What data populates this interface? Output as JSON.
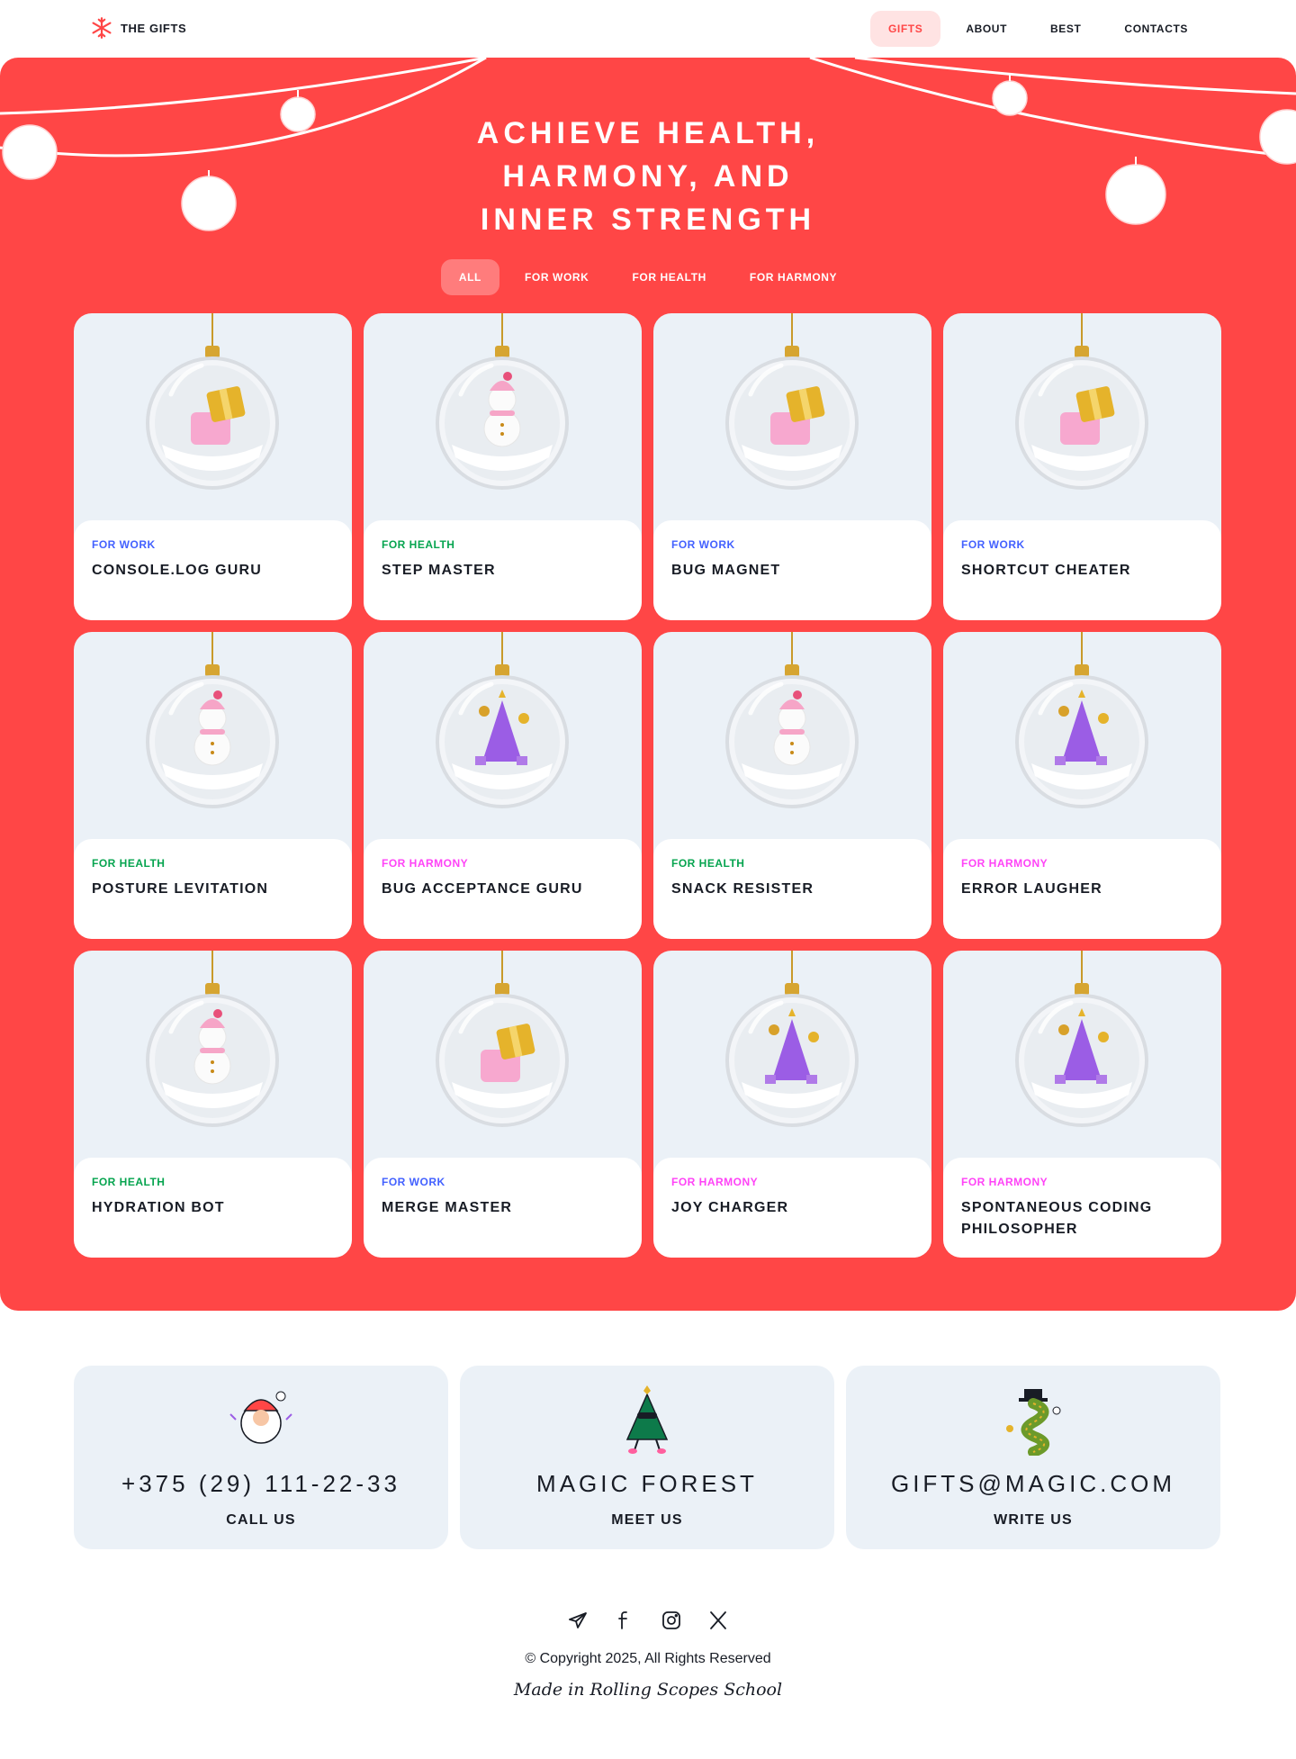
{
  "header": {
    "logo_text": "THE GIFTS",
    "nav": [
      {
        "label": "GIFTS",
        "active": true
      },
      {
        "label": "ABOUT",
        "active": false
      },
      {
        "label": "BEST",
        "active": false
      },
      {
        "label": "CONTACTS",
        "active": false
      }
    ]
  },
  "hero": {
    "title_lines": [
      "ACHIEVE HEALTH,",
      "HARMONY, AND",
      "INNER STRENGTH"
    ],
    "tabs": [
      {
        "label": "ALL",
        "active": true
      },
      {
        "label": "FOR WORK",
        "active": false
      },
      {
        "label": "FOR HEALTH",
        "active": false
      },
      {
        "label": "FOR HARMONY",
        "active": false
      }
    ]
  },
  "cards": [
    {
      "category": "FOR WORK",
      "name": "CONSOLE.LOG GURU",
      "type": "work",
      "toy": "gift"
    },
    {
      "category": "FOR HEALTH",
      "name": "STEP MASTER",
      "type": "health",
      "toy": "snowman"
    },
    {
      "category": "FOR WORK",
      "name": "BUG MAGNET",
      "type": "work",
      "toy": "gift"
    },
    {
      "category": "FOR WORK",
      "name": "SHORTCUT CHEATER",
      "type": "work",
      "toy": "gift"
    },
    {
      "category": "FOR HEALTH",
      "name": "POSTURE LEVITATION",
      "type": "health",
      "toy": "snowman"
    },
    {
      "category": "FOR HARMONY",
      "name": "BUG ACCEPTANCE GURU",
      "type": "harmony",
      "toy": "tree"
    },
    {
      "category": "FOR HEALTH",
      "name": "SNACK RESISTER",
      "type": "health",
      "toy": "snowman"
    },
    {
      "category": "FOR HARMONY",
      "name": "ERROR LAUGHER",
      "type": "harmony",
      "toy": "tree"
    },
    {
      "category": "FOR HEALTH",
      "name": "HYDRATION BOT",
      "type": "health",
      "toy": "snowman"
    },
    {
      "category": "FOR WORK",
      "name": "MERGE MASTER",
      "type": "work",
      "toy": "gift"
    },
    {
      "category": "FOR HARMONY",
      "name": "JOY CHARGER",
      "type": "harmony",
      "toy": "tree"
    },
    {
      "category": "FOR HARMONY",
      "name": "SPONTANEOUS CODING PHILOSOPHER",
      "type": "harmony",
      "toy": "tree"
    }
  ],
  "contacts": [
    {
      "value": "+375 (29) 111-22-33",
      "label": "CALL US",
      "illus": "santa"
    },
    {
      "value": "MAGIC FOREST",
      "label": "MEET US",
      "illus": "christmas-tree"
    },
    {
      "value": "GIFTS@MAGIC.COM",
      "label": "WRITE US",
      "illus": "snake"
    }
  ],
  "footer": {
    "socials": [
      "telegram-icon",
      "facebook-icon",
      "instagram-icon",
      "x-icon"
    ],
    "copyright": "© Copyright 2025, All Rights Reserved",
    "made_in": "Made in Rolling Scopes School"
  },
  "colors": {
    "accent": "#ff4646",
    "work": "#4361ff",
    "health": "#06a44f",
    "harmony": "#ff43f7",
    "card_bg": "#ebf1f7"
  }
}
